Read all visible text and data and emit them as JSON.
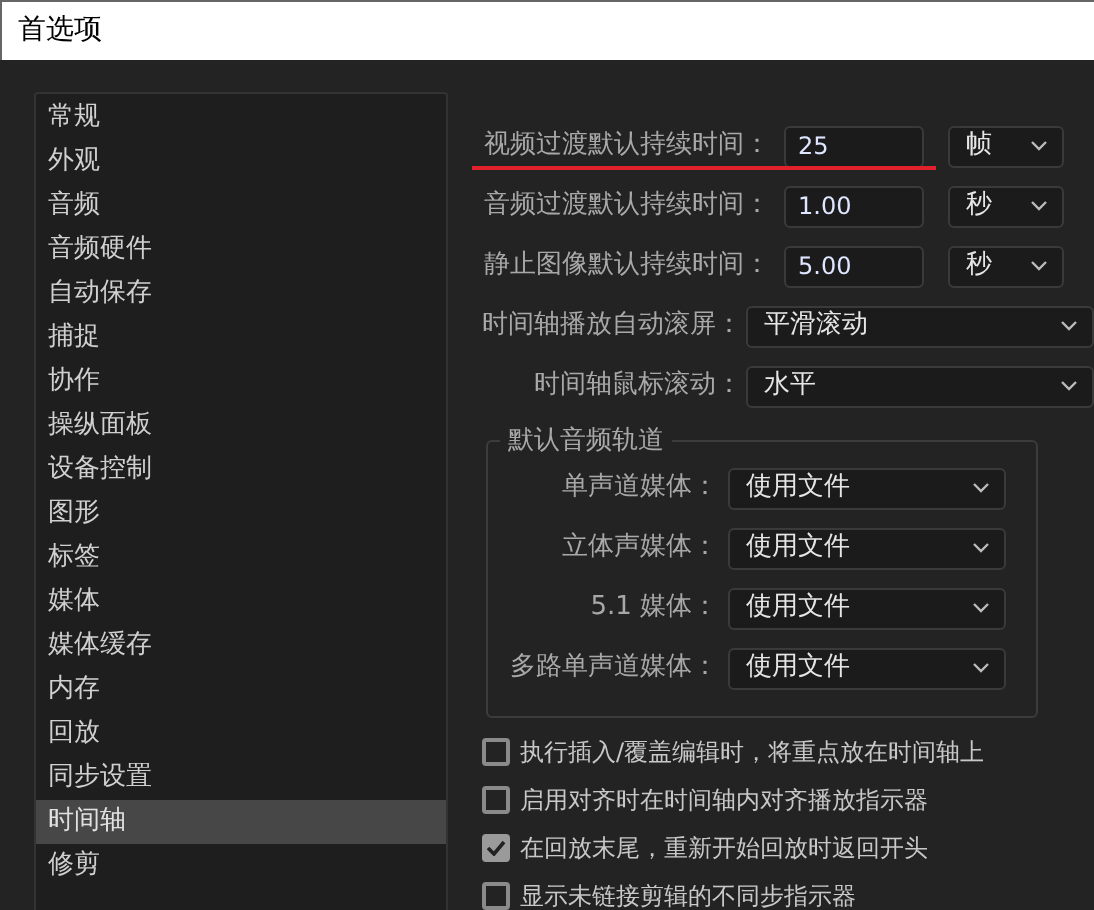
{
  "window": {
    "title": "首选项"
  },
  "sidebar": {
    "items": [
      {
        "label": "常规",
        "selected": false
      },
      {
        "label": "外观",
        "selected": false
      },
      {
        "label": "音频",
        "selected": false
      },
      {
        "label": "音频硬件",
        "selected": false
      },
      {
        "label": "自动保存",
        "selected": false
      },
      {
        "label": "捕捉",
        "selected": false
      },
      {
        "label": "协作",
        "selected": false
      },
      {
        "label": "操纵面板",
        "selected": false
      },
      {
        "label": "设备控制",
        "selected": false
      },
      {
        "label": "图形",
        "selected": false
      },
      {
        "label": "标签",
        "selected": false
      },
      {
        "label": "媒体",
        "selected": false
      },
      {
        "label": "媒体缓存",
        "selected": false
      },
      {
        "label": "内存",
        "selected": false
      },
      {
        "label": "回放",
        "selected": false
      },
      {
        "label": "同步设置",
        "selected": false
      },
      {
        "label": "时间轴",
        "selected": true
      },
      {
        "label": "修剪",
        "selected": false
      }
    ]
  },
  "settings": [
    {
      "kind": "duration",
      "label": "视频过渡默认持续时间：",
      "value": "25",
      "unit": "帧",
      "highlighted": true
    },
    {
      "kind": "duration",
      "label": "音频过渡默认持续时间：",
      "value": "1.00",
      "unit": "秒",
      "highlighted": false
    },
    {
      "kind": "duration",
      "label": "静止图像默认持续时间：",
      "value": "5.00",
      "unit": "秒",
      "highlighted": false
    },
    {
      "kind": "select",
      "label": "时间轴播放自动滚屏：",
      "value": "平滑滚动"
    },
    {
      "kind": "select",
      "label": "时间轴鼠标滚动：",
      "value": "水平"
    }
  ],
  "audio_tracks": {
    "title": "默认音频轨道",
    "rows": [
      {
        "label": "单声道媒体：",
        "value": "使用文件"
      },
      {
        "label": "立体声媒体：",
        "value": "使用文件"
      },
      {
        "label": "5.1 媒体：",
        "value": "使用文件"
      },
      {
        "label": "多路单声道媒体：",
        "value": "使用文件"
      }
    ]
  },
  "checkboxes": [
    {
      "label": "执行插入/覆盖编辑时，将重点放在时间轴上",
      "checked": false
    },
    {
      "label": "启用对齐时在时间轴内对齐播放指示器",
      "checked": false
    },
    {
      "label": "在回放末尾，重新开始回放时返回开头",
      "checked": true
    },
    {
      "label": "显示未链接剪辑的不同步指示器",
      "checked": false
    }
  ]
}
